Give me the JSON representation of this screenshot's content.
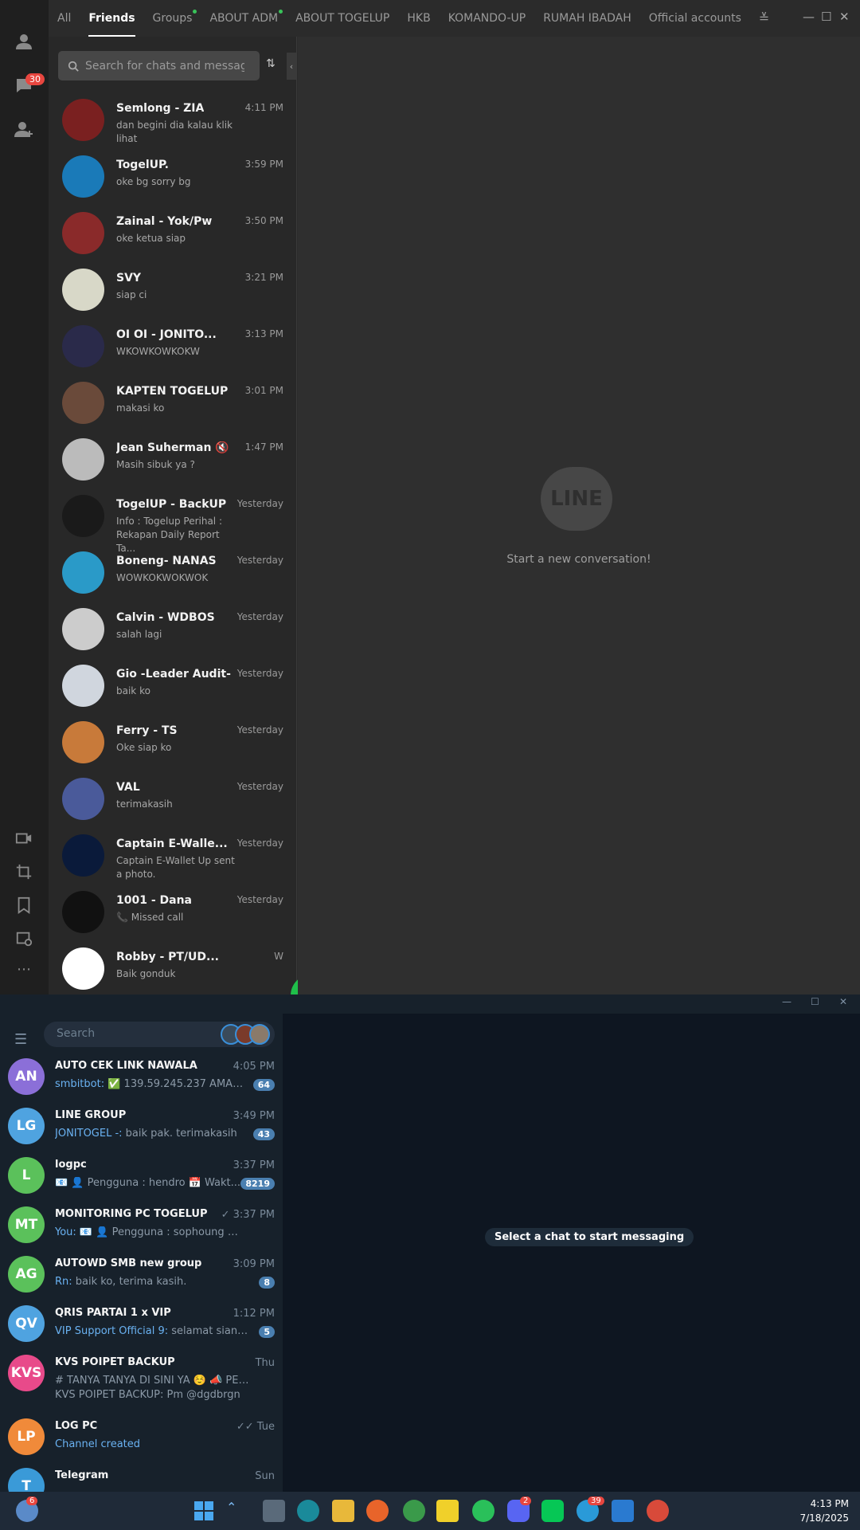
{
  "line": {
    "unread_badge": "30",
    "tabs": [
      "All",
      "Friends",
      "Groups",
      "ABOUT ADM",
      "ABOUT TOGELUP",
      "HKB",
      "KOMANDO-UP",
      "RUMAH IBADAH",
      "Official accounts"
    ],
    "search_placeholder": "Search for chats and messages",
    "chats": [
      {
        "name": "Semlong - ZIA",
        "preview": "dan begini dia kalau klik lihat",
        "time": "4:11 PM",
        "color": "#7a2020"
      },
      {
        "name": "TogelUP.",
        "preview": "oke bg sorry bg",
        "time": "3:59 PM",
        "color": "#1a7ab8"
      },
      {
        "name": "Zainal - Yok/Pw",
        "preview": "oke ketua siap",
        "time": "3:50 PM",
        "color": "#8a2a2a"
      },
      {
        "name": "SVY",
        "preview": "siap ci",
        "time": "3:21 PM",
        "color": "#d8d8c8"
      },
      {
        "name": "OI OI - JONITO...",
        "preview": "WKOWKOWKOKW",
        "time": "3:13 PM",
        "color": "#2a2a4a"
      },
      {
        "name": "KAPTEN TOGELUP",
        "preview": "makasi ko",
        "time": "3:01 PM",
        "color": "#6a4a3a"
      },
      {
        "name": "Jean Suherman 🔇",
        "preview": "Masih sibuk ya ?",
        "time": "1:47 PM",
        "color": "#bbbbbb"
      },
      {
        "name": "TogelUP - BackUP",
        "preview": "Info : Togelup Perihal : Rekapan Daily Report Ta...",
        "time": "Yesterday",
        "color": "#1a1a1a"
      },
      {
        "name": "Boneng- NANAS",
        "preview": "WOWKOKWOKWOK",
        "time": "Yesterday",
        "color": "#2a9ac8"
      },
      {
        "name": "Calvin - WDBOS",
        "preview": "salah lagi",
        "time": "Yesterday",
        "color": "#cccccc"
      },
      {
        "name": "Gio -Leader Audit-",
        "preview": "baik ko",
        "time": "Yesterday",
        "color": "#d0d6de"
      },
      {
        "name": "Ferry - TS",
        "preview": "Oke siap ko",
        "time": "Yesterday",
        "color": "#c87a3a"
      },
      {
        "name": "VAL",
        "preview": "terimakasih",
        "time": "Yesterday",
        "color": "#4a5a9a"
      },
      {
        "name": "Captain E-Walle...",
        "preview": "Captain E-Wallet Up sent a photo.",
        "time": "Yesterday",
        "color": "#0a1a3a"
      },
      {
        "name": "1001 - Dana",
        "preview": "📞 Missed call",
        "time": "Yesterday",
        "color": "#111111"
      },
      {
        "name": "Robby - PT/UD...",
        "preview": "Baik gonduk",
        "time": "W",
        "color": "#ffffff"
      }
    ],
    "empty_logo": "LINE",
    "empty_text": "Start a new conversation!"
  },
  "telegram": {
    "search_placeholder": "Search",
    "empty_text": "Select a chat to start messaging",
    "chats": [
      {
        "initials": "AN",
        "name": "AUTO CEK LINK NAWALA",
        "sender": "smbitbot:",
        "preview": " ✅ 139.59.245.237 AMAN ✅ ...",
        "time": "4:05 PM",
        "count": "64",
        "color": "#8b6fd8"
      },
      {
        "initials": "LG",
        "name": "LINE GROUP",
        "sender": "JONITOGEL -:",
        "preview": " baik pak. terimakasih",
        "time": "3:49 PM",
        "count": "43",
        "color": "#4fa3e0"
      },
      {
        "initials": "L",
        "name": "logpc",
        "sender": "",
        "preview": "📧 👤 Pengguna    : hendro 📅 Wakt...",
        "time": "3:37 PM",
        "count": "8219",
        "color": "#5bc15b"
      },
      {
        "initials": "MT",
        "name": "MONITORING PC TOGELUP",
        "sender": "You:",
        "preview": " 📧 👤 Pengguna    : sophoung 📅 Wak...",
        "time": "✓ 3:37 PM",
        "count": "",
        "color": "#5bc15b"
      },
      {
        "initials": "AG",
        "name": "AUTOWD SMB new group",
        "sender": "Rn:",
        "preview": " baik ko, terima kasih.",
        "time": "3:09 PM",
        "count": "8",
        "color": "#5bc15b"
      },
      {
        "initials": "QV",
        "name": "QRIS PARTAI 1 x VIP",
        "sender": "VIP Support Official 9:",
        "preview": " selamat siang pak, ...",
        "time": "1:12 PM",
        "count": "5",
        "color": "#4fa3e0"
      },
      {
        "initials": "KVS",
        "name": "KVS POIPET BACKUP",
        "sender": "",
        "preview": "# TANYA TANYA DI SINI YA ☺️ 📣 PENGUM...",
        "preview2": "KVS POIPET BACKUP: Pm @dgdbrgn",
        "time": "Thu",
        "count": "",
        "color": "#e84a8a"
      },
      {
        "initials": "LP",
        "name": "LOG PC",
        "sender": "Channel created",
        "preview": "",
        "time": "✓✓ Tue",
        "count": "",
        "color": "#f08a3a"
      },
      {
        "initials": "T",
        "name": "Telegram",
        "sender": "",
        "preview": "",
        "time": "Sun",
        "count": "",
        "color": "#3a9ad8"
      }
    ]
  },
  "taskbar": {
    "weather_badge": "6",
    "discord_badge": "2",
    "telegram_badge": "39",
    "time": "4:13 PM",
    "date": "7/18/2025"
  }
}
